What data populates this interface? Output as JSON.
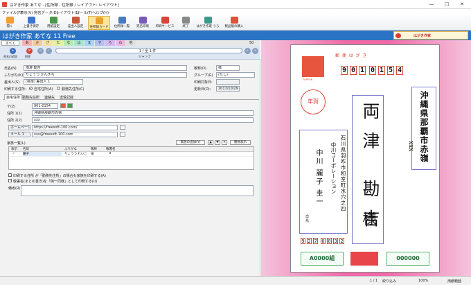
{
  "window": {
    "title": "はがき作家 あてな - [住所録 - 住所録 / レイアウト: レイアウト]"
  },
  "menu": [
    "ファイル(F)",
    "表示(V)",
    "宛名データ(D)",
    "レイアウト(L)",
    "ツール(T)",
    "ヘルプ(H)"
  ],
  "toolbar": [
    {
      "label": "開く",
      "color": "#f0a030"
    },
    {
      "label": "上書き保存",
      "color": "#3a78c8"
    },
    {
      "label": "用紙設定",
      "color": "#4a9a4a"
    },
    {
      "label": "差出人設定",
      "color": "#c85a3a"
    },
    {
      "label": "住所録カード",
      "color": "#e9a12a",
      "active": true
    },
    {
      "label": "住所録一覧",
      "color": "#4a7ab8"
    },
    {
      "label": "宛名印刷",
      "color": "#7a5ab8"
    },
    {
      "label": "印刷サービス",
      "color": "#d8463a"
    },
    {
      "label": "終了",
      "color": "#888888"
    },
    {
      "label": "はがき作家 うら",
      "color": "#3a9a8a"
    },
    {
      "label": "製品版の購入",
      "color": "#e0503a"
    }
  ],
  "app": {
    "name": "はがき作家 あてな 11 Free",
    "banner": "はがき作家"
  },
  "tabs": {
    "all": "すべて",
    "kana": [
      "あ",
      "か",
      "さ",
      "た",
      "な",
      "は",
      "ま",
      "や",
      "ら",
      "わ",
      "他"
    ],
    "count": "50"
  },
  "nav": {
    "page": "1 / 全 1 件",
    "jump": "ジャンプ",
    "left_labels": [
      "宛名の追加",
      "削除"
    ]
  },
  "form": {
    "name_label": "氏名(N)",
    "name_value": "両津 勘吉",
    "kana_label": "ふりがな(K)",
    "kana_value": "りょうつ かんきち",
    "sender_label": "差出人(S)",
    "sender_value": "(標準) 差出人 1",
    "print_label": "印刷する住所:",
    "radio_home": "自宅住所(A)",
    "radio_work": "勤務先住所(C)",
    "title_label": "敬称(O)",
    "title_value": "様",
    "group_label": "グループ(G)",
    "group_value": "(なし)",
    "printdate_label": "印刷対象日:",
    "printdate_value": "",
    "updated_label": "更新日(D):",
    "updated_value": "2017/10/29"
  },
  "subtabs": [
    "自宅住所",
    "勤務先住所",
    "連絡先",
    "送受記録"
  ],
  "address": {
    "zip_label": "〒(Z)",
    "zip_value": "901-0154",
    "addr1_label": "住所 1(1)",
    "addr1_value": "沖縄県那覇市赤嶺",
    "addr2_label": "住所 2(2)",
    "addr2_value": "xxx",
    "homepage_label": "ホームページ",
    "homepage_value": "https://freesoft-100.com/",
    "mail_label": "メール 1",
    "mail_value": "xxx@freesoft-100.com"
  },
  "family": {
    "title": "家族一覧(L)",
    "add_button": "家族の追加(Y)",
    "view_button": "簡易表示",
    "columns": [
      "表示",
      "名前",
      "ふりがな",
      "敬称",
      "敬署名"
    ],
    "rows": [
      {
        "show": "✓",
        "name": "麗子",
        "kana": "りょうつ れいこ",
        "honor": "様",
        "mark": "★"
      }
    ]
  },
  "options": {
    "opt1": "印刷する住所 が「勤務先住所」の場合も家族を印刷する(A)",
    "opt2": "敬署名(まとめ書き)を「御一同様」として印刷する(U)",
    "memo_label": "備考(R)"
  },
  "card": {
    "stamp_text": "NIPPON",
    "post_text": "郵 便 は が き",
    "zip_digits": [
      "9",
      "0",
      "1",
      "0",
      "1",
      "5",
      "4"
    ],
    "recipient_addr": "沖縄県那覇市赤嶺",
    "recipient_addr2": "xxx",
    "recipient_name": "両津 勘吉",
    "recipient_honor": "様",
    "nenga": "年賀",
    "sender_addr": "石川県羽咋市和室町水穴之四",
    "sender_company": "中川コーポレーション",
    "sender_names": "中川 麗子 圭一",
    "sender_suffix": "白 鳥",
    "sender_zip": [
      "9",
      "2",
      "7",
      "0",
      "0",
      "3",
      "2"
    ],
    "lotto1": "A0000組",
    "lotto2": "000000"
  },
  "status": {
    "count": "1 / 1",
    "filter": "絞り込み",
    "zoom": "100%",
    "layout": "用紙範囲"
  }
}
